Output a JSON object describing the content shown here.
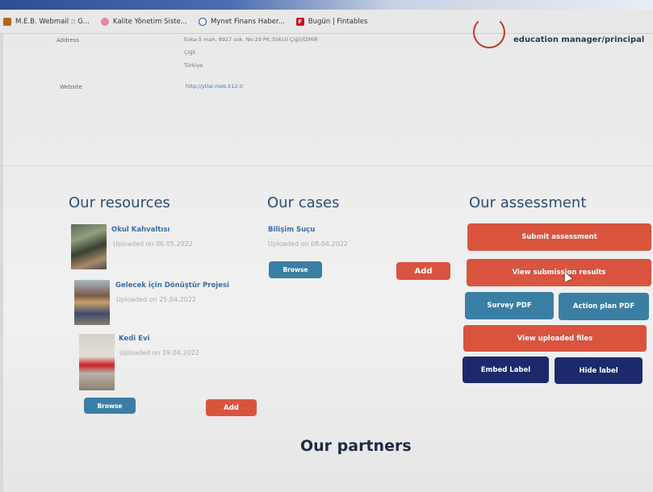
{
  "browser": {
    "bookmarks": [
      {
        "label": "M.E.B. Webmail :: G...",
        "icon": "meb-icon"
      },
      {
        "label": "Kalite Yönetim Siste...",
        "icon": "kalite-icon"
      },
      {
        "label": "Mynet Finans Haber...",
        "icon": "mynet-icon"
      },
      {
        "label": "Bugün | Fintables",
        "icon": "fintables-icon"
      }
    ]
  },
  "org": {
    "address_label": "Address",
    "address_line1": "Evka-5 mah. 8927 sok. No:29 PK:35610 Çiğli/İZMİR",
    "address_line2": "Çiğli",
    "address_line3": "Türkiye",
    "website_label": "Website",
    "website_url": "http://ytlal.meb.k12.tr",
    "role": "education manager/principal"
  },
  "resources": {
    "title": "Our resources",
    "items": [
      {
        "title": "Okul Kahvaltısı",
        "date": "Uploaded on 06.05.2022"
      },
      {
        "title": "Gelecek için Dönüştür Projesi",
        "date": "Uploaded on 25.04.2022"
      },
      {
        "title": "Kedi Evi",
        "date": "Uploaded on 19.04.2022"
      }
    ],
    "browse_label": "Browse",
    "add_label": "Add"
  },
  "cases": {
    "title": "Our cases",
    "items": [
      {
        "title": "Bilişim Suçu",
        "date": "Uploaded on 08.04.2022"
      }
    ],
    "browse_label": "Browse",
    "add_label": "Add"
  },
  "assessment": {
    "title": "Our assessment",
    "submit_label": "Submit assessment",
    "view_results_label": "View submission results",
    "survey_pdf_label": "Survey PDF",
    "action_plan_label": "Action plan PDF",
    "view_files_label": "View uploaded files",
    "embed_label": "Embed Label",
    "hide_label": "Hide label"
  },
  "partners": {
    "title": "Our partners"
  },
  "colors": {
    "teal": "#3a7fa3",
    "red": "#d9543f",
    "navy": "#1c2a6b",
    "heading": "#2c4f75"
  }
}
